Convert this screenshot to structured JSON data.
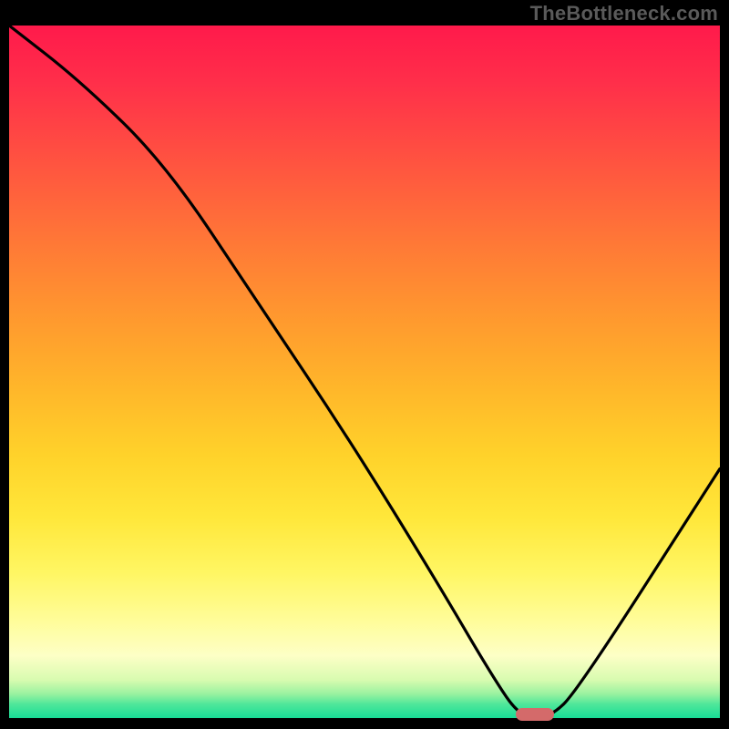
{
  "watermark": "TheBottleneck.com",
  "chart_data": {
    "type": "line",
    "title": "",
    "xlabel": "",
    "ylabel": "",
    "xlim": [
      0,
      100
    ],
    "ylim": [
      0,
      100
    ],
    "grid": false,
    "legend": false,
    "series": [
      {
        "name": "bottleneck-curve",
        "x": [
          0,
          10,
          22,
          35,
          48,
          60,
          68,
          72,
          76,
          80,
          100
        ],
        "y": [
          100,
          92,
          80,
          60,
          40,
          20,
          6,
          0,
          0,
          4,
          36
        ]
      }
    ],
    "marker": {
      "x": 74,
      "y": 0,
      "color": "#d46a6a"
    },
    "colors": {
      "curve": "#000000",
      "background_top": "#ff1a4b",
      "background_bottom": "#18dc96"
    }
  }
}
